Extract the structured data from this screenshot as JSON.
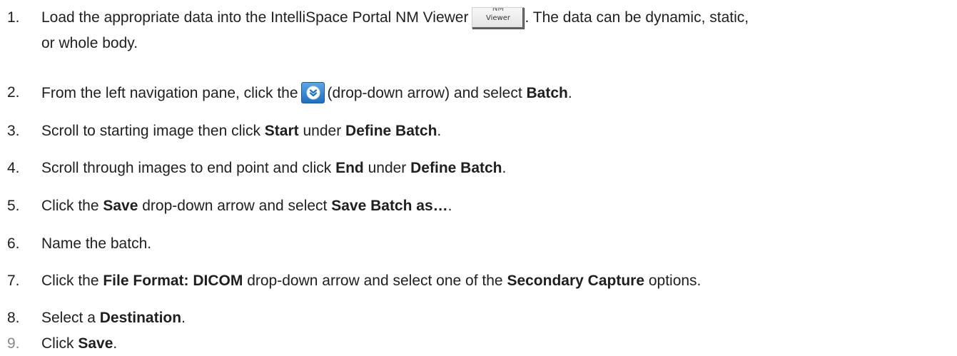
{
  "steps": [
    {
      "number": "1.",
      "text_before": "Load the appropriate data into the IntelliSpace Portal NM Viewer",
      "button": {
        "line1": "NM",
        "line2": "Viewer"
      },
      "text_after": ". The data can be dynamic, static,",
      "continuation": "or whole body."
    },
    {
      "number": "2.",
      "text_before": "From the left navigation pane, click the",
      "icon": "drop-down-arrow-icon",
      "text_mid": "(drop-down arrow) and select ",
      "bold1": "Batch",
      "text_after": "."
    },
    {
      "number": "3.",
      "t1": "Scroll to starting image then click ",
      "b1": "Start",
      "t2": " under ",
      "b2": "Define Batch",
      "t3": "."
    },
    {
      "number": "4.",
      "t1": "Scroll through images to end point and click ",
      "b1": "End",
      "t2": " under ",
      "b2": "Define Batch",
      "t3": "."
    },
    {
      "number": "5.",
      "t1": "Click the ",
      "b1": "Save",
      "t2": " drop-down arrow and select ",
      "b2": "Save Batch as…",
      "t3": "."
    },
    {
      "number": "6.",
      "t1": "Name the batch."
    },
    {
      "number": "7.",
      "t1": "Click the ",
      "b1": "File Format: DICOM",
      "t2": " drop-down arrow and select one of the ",
      "b2": "Secondary Capture",
      "t3": " options."
    },
    {
      "number": "8.",
      "t1": "Select a ",
      "b1": "Destination",
      "t2": "."
    },
    {
      "number": "9.",
      "t1": "Click ",
      "b1": "Save",
      "t2": "."
    }
  ],
  "colors": {
    "text": "#1f1f1f",
    "muted_number": "#888888",
    "icon_blue": "#1f6fbf"
  }
}
